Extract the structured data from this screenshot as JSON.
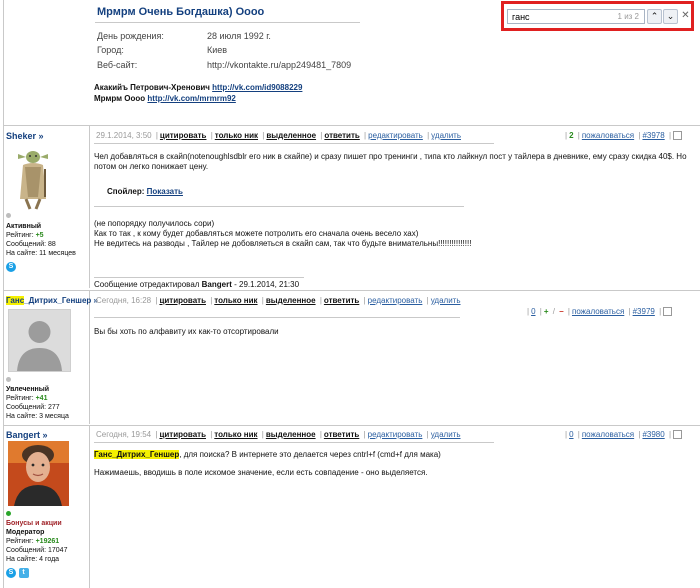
{
  "profile": {
    "title": "Мрмрм Очень Богдашка) Оооо",
    "rows": [
      {
        "label": "День рождения:",
        "value": "28 июля 1992 г."
      },
      {
        "label": "Город:",
        "value": "Киев"
      },
      {
        "label": "Веб-сайт:",
        "value": "http://vkontakte.ru/app249481_7809"
      }
    ],
    "lines": [
      {
        "prefix": "Акакийъ Петрович-Хренович ",
        "link": "http://vk.com/id9088229"
      },
      {
        "prefix": "Мрмрм Оооо ",
        "link": "http://vk.com/mrmrm92"
      }
    ]
  },
  "findbar": {
    "query": "ганс",
    "count": "1 из 2",
    "prev_icon": "chevron-up-icon",
    "next_icon": "chevron-down-icon",
    "close_icon": "close-icon",
    "border_color": "#e02020"
  },
  "toolbar_labels": {
    "quote": "цитировать",
    "nick": "только ник",
    "selected": "выделенное",
    "reply": "ответить",
    "edit": "редактировать",
    "delete": "удалить",
    "complain": "пожаловаться"
  },
  "posts": [
    {
      "author": "Sheker »",
      "date": "29.1.2014, 3:50",
      "rank": "Активный",
      "rating_label": "Рейтинг: ",
      "rating": "+5",
      "messages": "Сообщений: 88",
      "online": "На сайте: 11 месяцев",
      "reply_count": "2",
      "post_no": "#3978",
      "body1": "Чел добавляться в скайп(notenoughlsdblr его ник в скайпе) и сразу пишет про тренинги , типа кто лайкнул пост у тайлера в дневнике, ему сразу скидка 40$. Но потом он легко понижает цену.",
      "spoiler_label": "Спойлер: ",
      "spoiler_link": "Показать",
      "body2": [
        "(не попорядку получилось сори)",
        "Как то так , к кому будет добавляться можете потролить его сначала очень весело хах)",
        "Не ведитесь на разводы , Тайлер не добовляеться в скайп сам, так что будьте внимательны!!!!!!!!!!!!!!!"
      ],
      "edited_prefix": "Сообщение отредактировал ",
      "edited_by": "Bangert",
      "edited_suffix": " - 29.1.2014, 21:30"
    },
    {
      "author": "Ганс_Дитрих_Геншер »",
      "author_highlight": "Ганс",
      "author_rest": "_Дитрих_Геншер »",
      "date": "Сегодня, 16:28",
      "rank": "Увлеченный",
      "rating_label": "Рейтинг: ",
      "rating": "+41",
      "messages": "Сообщений: 277",
      "online": "На сайте: 3 месяца",
      "reply_count": "0",
      "post_no": "#3979",
      "body": "Вы бы хоть по алфавиту их как-то отсортировали"
    },
    {
      "author": "Bangert »",
      "date": "Сегодня, 19:54",
      "group": "Бонусы и акции",
      "rank": "Модератор",
      "rating_label": "Рейтинг: ",
      "rating": "+19261",
      "messages": "Сообщений: 17047",
      "online": "На сайте: 4 года",
      "reply_count": "0",
      "post_no": "#3980",
      "body_highlight": "Ганс_Дитрих_Геншер",
      "body1_rest": ", для поиска? В интернете это делается через cntrl+f (cmd+f для мака)",
      "body2": "Нажимаешь, вводишь в поле искомое значение, если есть совпадение - оно выделяется."
    }
  ],
  "colors": {
    "link": "#14407f",
    "green": "#2a8a1d",
    "red": "#c62a1c",
    "highlight": "#f5f000"
  }
}
